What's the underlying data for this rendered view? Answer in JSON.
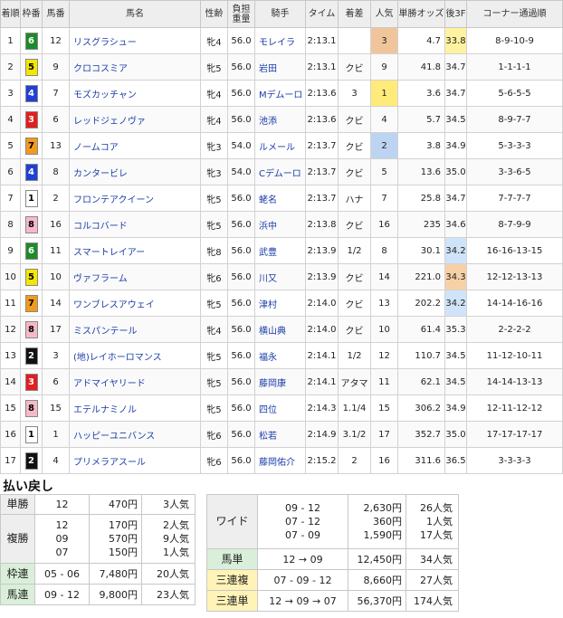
{
  "headers": {
    "rank": "着順",
    "waku": "枠番",
    "umaban": "馬番",
    "name": "馬名",
    "sexage": "性齢",
    "weight": "負担重量",
    "jockey": "騎手",
    "time": "タイム",
    "margin": "着差",
    "popularity": "人気",
    "odds": "単勝オッズ",
    "last3f": "後3F",
    "corner": "コーナー通過順"
  },
  "rows": [
    {
      "rank": "1",
      "waku": "6",
      "umaban": "12",
      "name": "リスグラシュー",
      "sexage": "牝4",
      "weight": "56.0",
      "jockey": "モレイラ",
      "time": "2:13.1",
      "margin": "",
      "pop": "3",
      "odds": "4.7",
      "last3f": "33.8",
      "corner": "8-9-10-9"
    },
    {
      "rank": "2",
      "waku": "5",
      "umaban": "9",
      "name": "クロコスミア",
      "sexage": "牝5",
      "weight": "56.0",
      "jockey": "岩田",
      "time": "2:13.1",
      "margin": "クビ",
      "pop": "9",
      "odds": "41.8",
      "last3f": "34.7",
      "corner": "1-1-1-1"
    },
    {
      "rank": "3",
      "waku": "4",
      "umaban": "7",
      "name": "モズカッチャン",
      "sexage": "牝4",
      "weight": "56.0",
      "jockey": "Mデムーロ",
      "time": "2:13.6",
      "margin": "3",
      "pop": "1",
      "odds": "3.6",
      "last3f": "34.7",
      "corner": "5-6-5-5"
    },
    {
      "rank": "4",
      "waku": "3",
      "umaban": "6",
      "name": "レッドジェノヴァ",
      "sexage": "牝4",
      "weight": "56.0",
      "jockey": "池添",
      "time": "2:13.6",
      "margin": "クビ",
      "pop": "4",
      "odds": "5.7",
      "last3f": "34.5",
      "corner": "8-9-7-7"
    },
    {
      "rank": "5",
      "waku": "7",
      "umaban": "13",
      "name": "ノームコア",
      "sexage": "牝3",
      "weight": "54.0",
      "jockey": "ルメール",
      "time": "2:13.7",
      "margin": "クビ",
      "pop": "2",
      "odds": "3.8",
      "last3f": "34.9",
      "corner": "5-3-3-3"
    },
    {
      "rank": "6",
      "waku": "4",
      "umaban": "8",
      "name": "カンタービレ",
      "sexage": "牝3",
      "weight": "54.0",
      "jockey": "Cデムーロ",
      "time": "2:13.7",
      "margin": "クビ",
      "pop": "5",
      "odds": "13.6",
      "last3f": "35.0",
      "corner": "3-3-6-5"
    },
    {
      "rank": "7",
      "waku": "1",
      "umaban": "2",
      "name": "フロンテアクイーン",
      "sexage": "牝5",
      "weight": "56.0",
      "jockey": "蛯名",
      "time": "2:13.7",
      "margin": "ハナ",
      "pop": "7",
      "odds": "25.8",
      "last3f": "34.7",
      "corner": "7-7-7-7"
    },
    {
      "rank": "8",
      "waku": "8",
      "umaban": "16",
      "name": "コルコバード",
      "sexage": "牝5",
      "weight": "56.0",
      "jockey": "浜中",
      "time": "2:13.8",
      "margin": "クビ",
      "pop": "16",
      "odds": "235",
      "last3f": "34.6",
      "corner": "8-7-9-9"
    },
    {
      "rank": "9",
      "waku": "6",
      "umaban": "11",
      "name": "スマートレイアー",
      "sexage": "牝8",
      "weight": "56.0",
      "jockey": "武豊",
      "time": "2:13.9",
      "margin": "1/2",
      "pop": "8",
      "odds": "30.1",
      "last3f": "34.2",
      "corner": "16-16-13-15"
    },
    {
      "rank": "10",
      "waku": "5",
      "umaban": "10",
      "name": "ヴァフラーム",
      "sexage": "牝6",
      "weight": "56.0",
      "jockey": "川又",
      "time": "2:13.9",
      "margin": "クビ",
      "pop": "14",
      "odds": "221.0",
      "last3f": "34.3",
      "corner": "12-12-13-13"
    },
    {
      "rank": "11",
      "waku": "7",
      "umaban": "14",
      "name": "ワンブレスアウェイ",
      "sexage": "牝5",
      "weight": "56.0",
      "jockey": "津村",
      "time": "2:14.0",
      "margin": "クビ",
      "pop": "13",
      "odds": "202.2",
      "last3f": "34.2",
      "corner": "14-14-16-16"
    },
    {
      "rank": "12",
      "waku": "8",
      "umaban": "17",
      "name": "ミスパンテール",
      "sexage": "牝4",
      "weight": "56.0",
      "jockey": "横山典",
      "time": "2:14.0",
      "margin": "クビ",
      "pop": "10",
      "odds": "61.4",
      "last3f": "35.3",
      "corner": "2-2-2-2"
    },
    {
      "rank": "13",
      "waku": "2",
      "umaban": "3",
      "name": "(地)レイホーロマンス",
      "sexage": "牝5",
      "weight": "56.0",
      "jockey": "福永",
      "time": "2:14.1",
      "margin": "1/2",
      "pop": "12",
      "odds": "110.7",
      "last3f": "34.5",
      "corner": "11-12-10-11"
    },
    {
      "rank": "14",
      "waku": "3",
      "umaban": "6",
      "name": "アドマイヤリード",
      "sexage": "牝5",
      "weight": "56.0",
      "jockey": "藤岡康",
      "time": "2:14.1",
      "margin": "アタマ",
      "pop": "11",
      "odds": "62.1",
      "last3f": "34.5",
      "corner": "14-14-13-13"
    },
    {
      "rank": "15",
      "waku": "8",
      "umaban": "15",
      "name": "エテルナミノル",
      "sexage": "牝5",
      "weight": "56.0",
      "jockey": "四位",
      "time": "2:14.3",
      "margin": "1.1/4",
      "pop": "15",
      "odds": "306.2",
      "last3f": "34.9",
      "corner": "12-11-12-12"
    },
    {
      "rank": "16",
      "waku": "1",
      "umaban": "1",
      "name": "ハッピーユニバンス",
      "sexage": "牝6",
      "weight": "56.0",
      "jockey": "松若",
      "time": "2:14.9",
      "margin": "3.1/2",
      "pop": "17",
      "odds": "352.7",
      "last3f": "35.0",
      "corner": "17-17-17-17"
    },
    {
      "rank": "17",
      "waku": "2",
      "umaban": "4",
      "name": "プリメラアスール",
      "sexage": "牝6",
      "weight": "56.0",
      "jockey": "藤岡佑介",
      "time": "2:15.2",
      "margin": "2",
      "pop": "16",
      "odds": "311.6",
      "last3f": "36.5",
      "corner": "3-3-3-3"
    }
  ],
  "waku_colors": {
    "1": {
      "bg": "#ffffff",
      "fg": "#000000"
    },
    "2": {
      "bg": "#111111",
      "fg": "#ffffff"
    },
    "3": {
      "bg": "#e41d1d",
      "fg": "#ffffff"
    },
    "4": {
      "bg": "#1f3fd6",
      "fg": "#ffffff"
    },
    "5": {
      "bg": "#f5e600",
      "fg": "#000000"
    },
    "6": {
      "bg": "#1d8a2c",
      "fg": "#ffffff"
    },
    "7": {
      "bg": "#f29a1e",
      "fg": "#000000"
    },
    "8": {
      "bg": "#f7b9c9",
      "fg": "#000000"
    }
  },
  "payout": {
    "title": "払い戻し",
    "tansho": {
      "label": "単勝",
      "num": "12",
      "yen": "470円",
      "ninki": "3人気"
    },
    "fukusho": {
      "label": "複勝",
      "nums": [
        "12",
        "09",
        "07"
      ],
      "yens": [
        "170円",
        "570円",
        "150円"
      ],
      "ninkis": [
        "2人気",
        "9人気",
        "1人気"
      ]
    },
    "wakuren": {
      "label": "枠連",
      "num": "05 - 06",
      "yen": "7,480円",
      "ninki": "20人気"
    },
    "umaren": {
      "label": "馬連",
      "num": "09 - 12",
      "yen": "9,800円",
      "ninki": "23人気"
    },
    "wide": {
      "label": "ワイド",
      "nums": [
        "09 - 12",
        "07 - 12",
        "07 - 09"
      ],
      "yens": [
        "2,630円",
        "360円",
        "1,590円"
      ],
      "ninkis": [
        "26人気",
        "1人気",
        "17人気"
      ]
    },
    "umatan": {
      "label": "馬単",
      "num": "12 → 09",
      "yen": "12,450円",
      "ninki": "34人気"
    },
    "sanrenpuku": {
      "label": "三連複",
      "num": "07 - 09 - 12",
      "yen": "8,660円",
      "ninki": "27人気"
    },
    "sanrentan": {
      "label": "三連単",
      "num": "12 → 09 → 07",
      "yen": "56,370円",
      "ninki": "174人気"
    }
  }
}
